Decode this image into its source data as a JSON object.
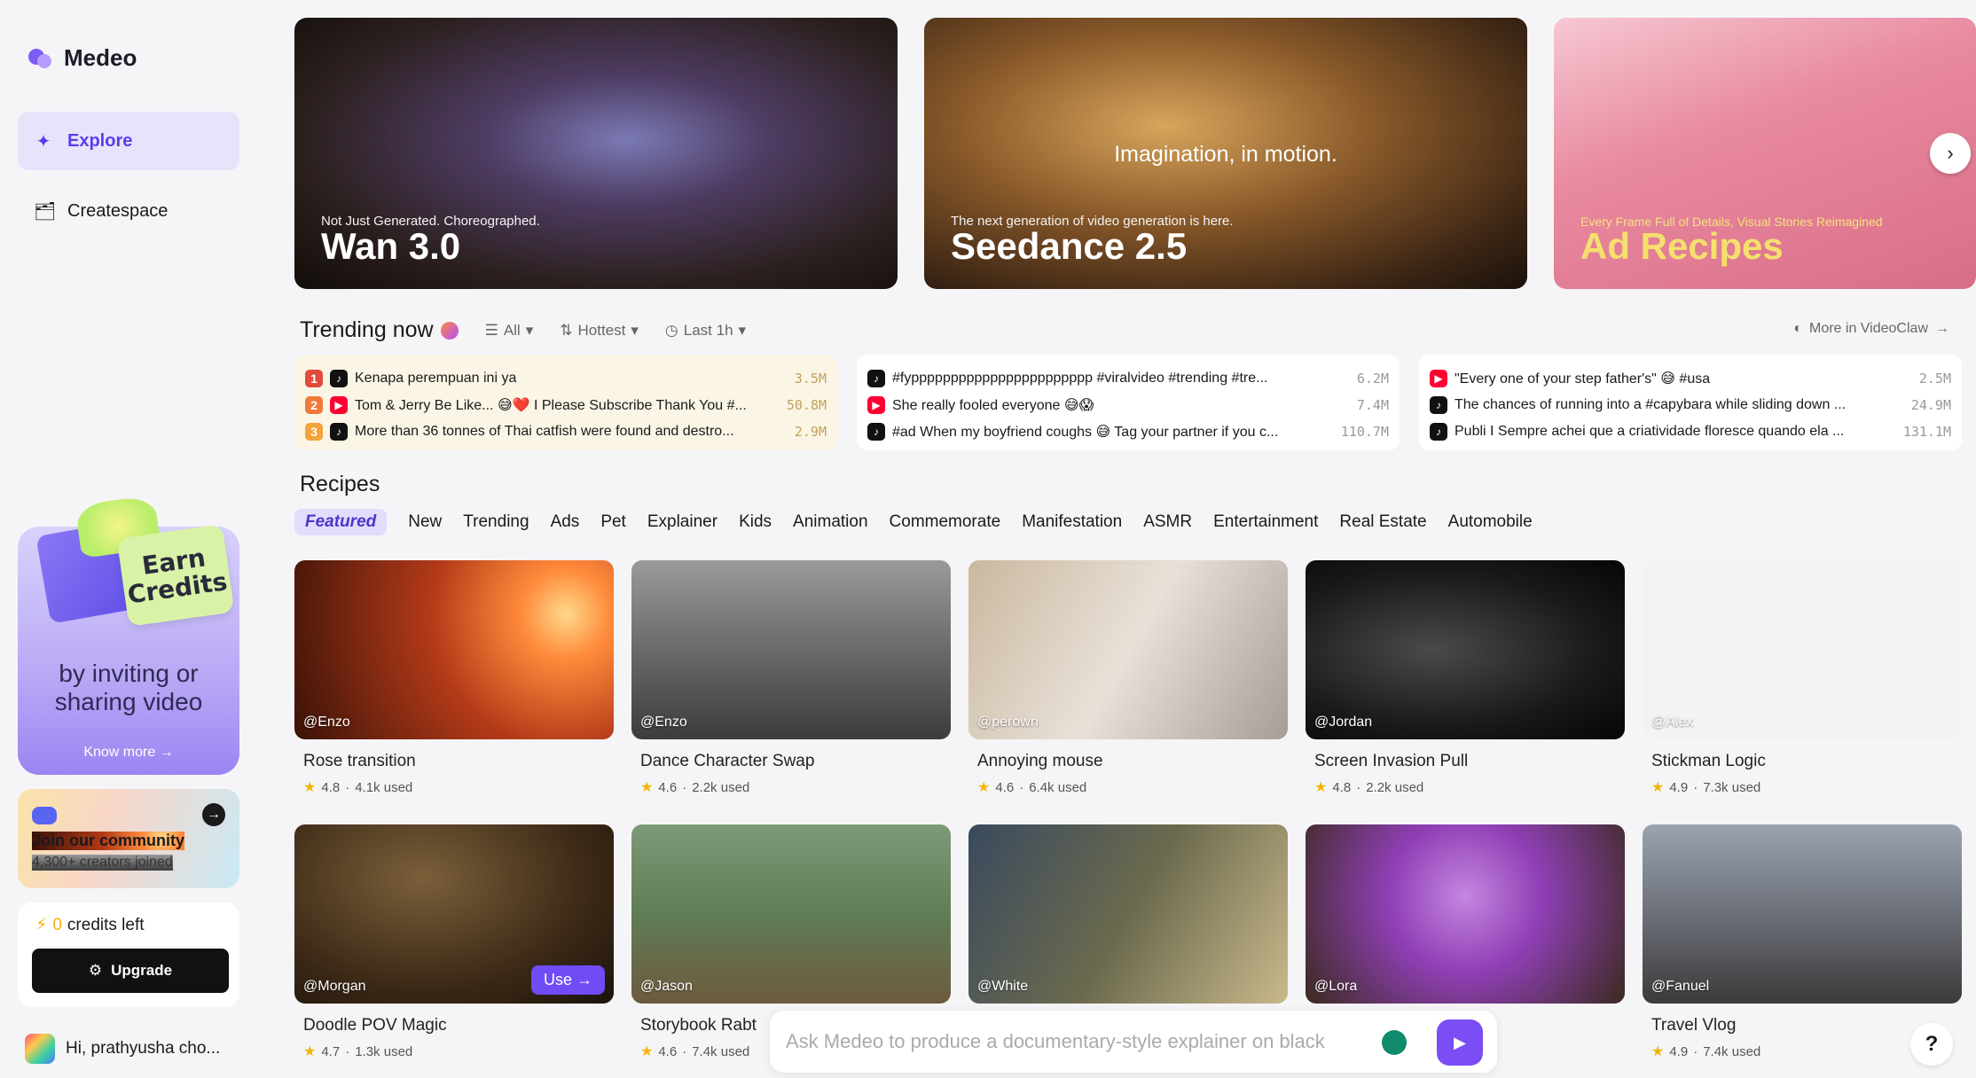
{
  "app": {
    "name": "Medeo"
  },
  "nav": [
    {
      "label": "Explore",
      "icon": "sparkle-icon",
      "active": true
    },
    {
      "label": "Createspace",
      "icon": "folder-icon",
      "active": false
    }
  ],
  "promo": {
    "card_line1": "Earn",
    "card_line2": "Credits",
    "text_line1": "by inviting or",
    "text_line2": "sharing video",
    "link": "Know more →"
  },
  "community": {
    "title": "Join our community",
    "subtitle": "4,300+ creators joined"
  },
  "credits": {
    "count": "0",
    "label": "credits left",
    "upgrade_label": "Upgrade"
  },
  "user": {
    "greeting": "Hi, prathyusha cho..."
  },
  "banners": [
    {
      "subtitle": "Not Just Generated. Choreographed.",
      "title": "Wan 3.0",
      "center": ""
    },
    {
      "subtitle": "The next generation of video generation is here.",
      "title": "Seedance 2.5",
      "center": "Imagination, in motion."
    },
    {
      "subtitle": "Every Frame Full of Details, Visual Stories Reimagined",
      "title": "Ad Recipes",
      "center": ""
    }
  ],
  "trending": {
    "title": "Trending now",
    "filters": [
      "All",
      "Hottest",
      "Last 1h"
    ],
    "more_link": "More in VideoClaw",
    "groups": [
      [
        {
          "rank": "1",
          "platform": "tiktok",
          "text": "Kenapa perempuan ini ya",
          "views": "3.5M"
        },
        {
          "rank": "2",
          "platform": "youtube",
          "text": "Tom & Jerry Be Like... 😅❤️ I Please Subscribe Thank You #...",
          "views": "50.8M"
        },
        {
          "rank": "3",
          "platform": "tiktok",
          "text": "More than 36 tonnes of Thai catfish were found and destro...",
          "views": "2.9M"
        }
      ],
      [
        {
          "platform": "tiktok",
          "text": "#fyppppppppppppppppppppppp #viralvideo #trending #tre...",
          "views": "6.2M"
        },
        {
          "platform": "youtube",
          "text": "She really fooled everyone 😅😱",
          "views": "7.4M"
        },
        {
          "platform": "tiktok",
          "text": "#ad When my boyfriend coughs 😅 Tag your partner if you c...",
          "views": "110.7M"
        }
      ],
      [
        {
          "platform": "youtube",
          "text": "\"Every one of your step father's\" 😅 #usa",
          "views": "2.5M"
        },
        {
          "platform": "tiktok",
          "text": "The chances of running into a #capybara while sliding down ...",
          "views": "24.9M"
        },
        {
          "platform": "tiktok",
          "text": "Publi I Sempre achei que a criatividade floresce quando ela ...",
          "views": "131.1M"
        }
      ]
    ]
  },
  "recipes": {
    "title": "Recipes",
    "tabs": [
      "Featured",
      "New",
      "Trending",
      "Ads",
      "Pet",
      "Explainer",
      "Kids",
      "Animation",
      "Commemorate",
      "Manifestation",
      "ASMR",
      "Entertainment",
      "Real Estate",
      "Automobile"
    ],
    "cards": [
      {
        "handle": "@Enzo",
        "name": "Rose transition",
        "rating": "4.8",
        "used": "4.1k used"
      },
      {
        "handle": "@Enzo",
        "name": "Dance Character Swap",
        "rating": "4.6",
        "used": "2.2k used"
      },
      {
        "handle": "@perown",
        "name": "Annoying mouse",
        "rating": "4.6",
        "used": "6.4k used"
      },
      {
        "handle": "@Jordan",
        "name": "Screen Invasion Pull",
        "rating": "4.8",
        "used": "2.2k used"
      },
      {
        "handle": "@Alex",
        "name": "Stickman Logic",
        "rating": "4.9",
        "used": "7.3k used"
      },
      {
        "handle": "@Morgan",
        "name": "Doodle POV Magic",
        "rating": "4.7",
        "used": "1.3k used",
        "use_label": "Use →"
      },
      {
        "handle": "@Jason",
        "name": "Storybook Rabt",
        "rating": "4.6",
        "used": "7.4k used"
      },
      {
        "handle": "@White",
        "name": "",
        "rating": "",
        "used": ""
      },
      {
        "handle": "@Lora",
        "name": "",
        "rating": "",
        "used": ""
      },
      {
        "handle": "@Fanuel",
        "name": "Travel Vlog",
        "rating": "4.9",
        "used": "7.4k used"
      }
    ]
  },
  "chat": {
    "placeholder": "Ask Medeo to produce a documentary-style explainer on black"
  },
  "help": "?"
}
